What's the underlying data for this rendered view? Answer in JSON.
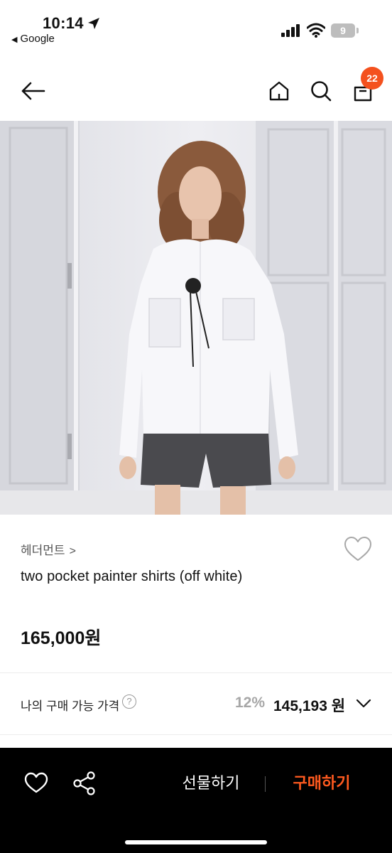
{
  "status_bar": {
    "time": "10:14",
    "back_app": "Google",
    "battery": "9"
  },
  "nav": {
    "cart_count": "22"
  },
  "product": {
    "brand": "헤더먼트",
    "brand_chevron": ">",
    "title": "two pocket painter shirts (off white)",
    "price": "165,000원"
  },
  "my_price": {
    "label": "나의 구매 가능 가격",
    "help": "?",
    "discount": "12%",
    "sale_price": "145,193 원"
  },
  "bottom_bar": {
    "gift_label": "선물하기",
    "buy_label": "구매하기"
  },
  "colors": {
    "accent": "#ff5a1f",
    "badge": "#f4511e",
    "bottom_bar_bg": "#000000"
  },
  "icons": [
    "location-arrow-icon",
    "back-triangle-icon",
    "signal-icon",
    "wifi-icon",
    "battery-icon",
    "back-arrow-icon",
    "home-icon",
    "search-icon",
    "shopping-bag-icon",
    "heart-outline-icon",
    "question-icon",
    "chevron-down-icon",
    "share-icon"
  ]
}
